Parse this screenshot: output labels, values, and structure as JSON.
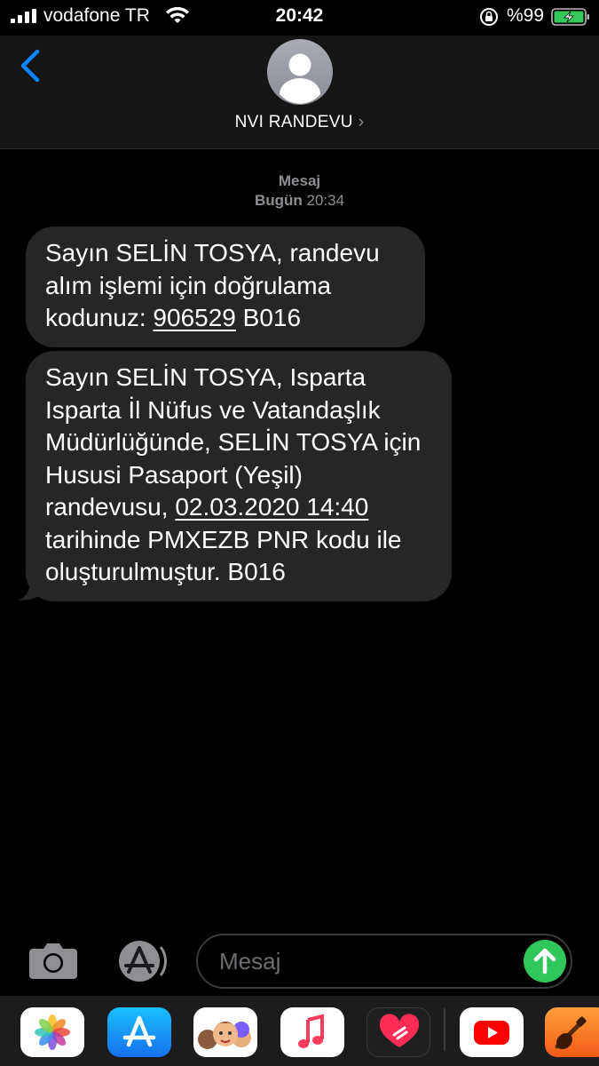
{
  "status_bar": {
    "carrier": "vodafone TR",
    "time": "20:42",
    "battery_percent": "%99"
  },
  "header": {
    "contact_name": "NVI RANDEVU",
    "chevron": "›"
  },
  "thread": {
    "service_label": "Mesaj",
    "day": "Bugün",
    "time": "20:34",
    "messages": [
      {
        "pre": "Sayın SELİN TOSYA, randevu alım işlemi için doğrulama kodunuz: ",
        "link": "906529",
        "post": " B016"
      },
      {
        "pre": "Sayın SELİN TOSYA, Isparta Isparta İl Nüfus ve Vatandaşlık Müdürlüğünde, SELİN TOSYA için Hususi Pasaport (Yeşil) randevusu, ",
        "link": "02.03.2020 14:40",
        "post": " tarihinde PMXEZB PNR kodu ile oluşturulmuştur. B016"
      }
    ]
  },
  "input_bar": {
    "placeholder": "Mesaj"
  },
  "app_drawer": {
    "apps": [
      "photos-icon",
      "appstore-icon",
      "memoji-icon",
      "music-icon",
      "digital-touch-icon",
      "youtube-icon",
      "garageband-icon"
    ]
  },
  "colors": {
    "background": "#000000",
    "bubble": "#262628",
    "accent": "#0a84ff",
    "send": "#30c75a",
    "muted": "#8e8e93"
  }
}
